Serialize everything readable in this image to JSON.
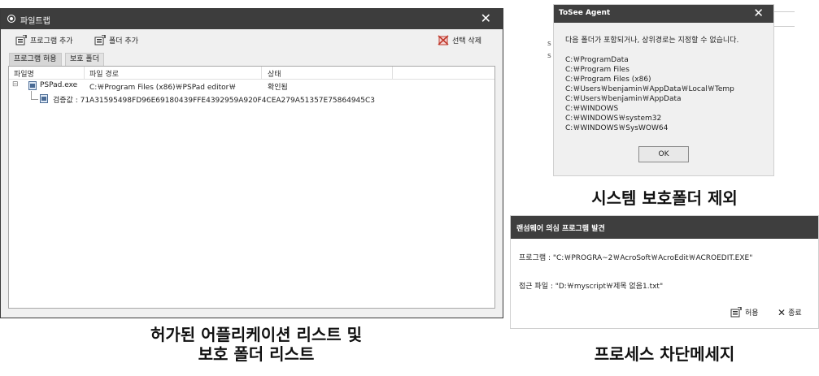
{
  "main_window": {
    "title": "파일트랩",
    "close_glyph": "✕",
    "toolbar": {
      "add_program": "프로그램 추가",
      "add_folder": "폴더 추가",
      "delete_selected": "선택 삭제"
    },
    "tabs": [
      "프로그램 허용",
      "보호 폴더"
    ],
    "columns": [
      "파일명",
      "파일 경로",
      "상태"
    ],
    "rows": [
      {
        "name": "PSPad.exe",
        "path": "C:￦Program Files (x86)￦PSPad editor￦",
        "status": "확인됨"
      }
    ],
    "hash_row": "검증값 : 71A31595498FD96E69180439FFE4392959A920F4CEA279A51357E75864945C3"
  },
  "caption_left": [
    "허가된 어플리케이션 리스트 및",
    "보호 폴더 리스트"
  ],
  "tosee_dialog": {
    "title": "ToSee Agent",
    "close_glyph": "✕",
    "message": "다음 폴더가 포함되거나, 상위경로는 지정할 수 없습니다.",
    "paths": [
      "C:￦ProgramData",
      "C:￦Program Files",
      "C:￦Program Files (x86)",
      "C:￦Users￦benjamin￦AppData￦Local￦Temp",
      "C:￦Users￦benjamin￦AppData",
      "C:￦WINDOWS",
      "C:￦WINDOWS￦system32",
      "C:￦WINDOWS￦SysWOW64"
    ],
    "ok_label": "OK"
  },
  "caption_tosee": "시스템 보호폴더 제외",
  "ransom_dialog": {
    "title": "랜섬웨어 의심 프로그램 발견",
    "program_line": "프로그램 : \"C:￦PROGRA~2￦AcroSoft￦AcroEdit￦ACROEDIT.EXE\"",
    "access_line": "접근 파일 : \"D:￦myscript￦제목 없음1.txt\"",
    "allow_label": "허용",
    "exit_label": "종료"
  },
  "caption_ransom": "프로세스 차단메세지",
  "colors": {
    "titlebar": "#3d3d3d",
    "window_bg": "#f0f0f0",
    "delete_icon": "#c0392b"
  }
}
